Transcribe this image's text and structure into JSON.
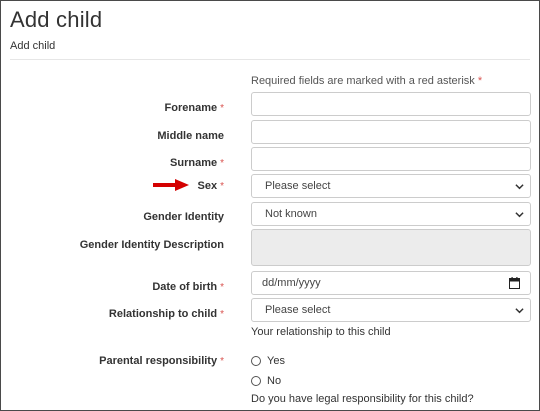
{
  "header": {
    "title": "Add child",
    "subtitle": "Add child"
  },
  "required_note": {
    "text": "Required fields are marked with a red asterisk",
    "star": "*"
  },
  "fields": {
    "forename": {
      "label": "Forename",
      "star": "*",
      "value": ""
    },
    "middle_name": {
      "label": "Middle name",
      "value": ""
    },
    "surname": {
      "label": "Surname",
      "star": "*",
      "value": ""
    },
    "sex": {
      "label": "Sex",
      "star": "*",
      "selected": "Please select"
    },
    "gender_identity": {
      "label": "Gender Identity",
      "selected": "Not known"
    },
    "gender_identity_description": {
      "label": "Gender Identity Description",
      "value": ""
    },
    "date_of_birth": {
      "label": "Date of birth",
      "star": "*",
      "placeholder": "dd/mm/yyyy"
    },
    "relationship": {
      "label": "Relationship to child",
      "star": "*",
      "selected": "Please select",
      "help": "Your relationship to this child"
    },
    "parental_responsibility": {
      "label": "Parental responsibility",
      "star": "*",
      "options": [
        "Yes",
        "No"
      ],
      "help": "Do you have legal responsibility for this child?"
    }
  },
  "colors": {
    "required_star": "#d9534f",
    "annotation_arrow": "#d40000",
    "disabled_bg": "#ececec",
    "border": "#cccccc"
  }
}
